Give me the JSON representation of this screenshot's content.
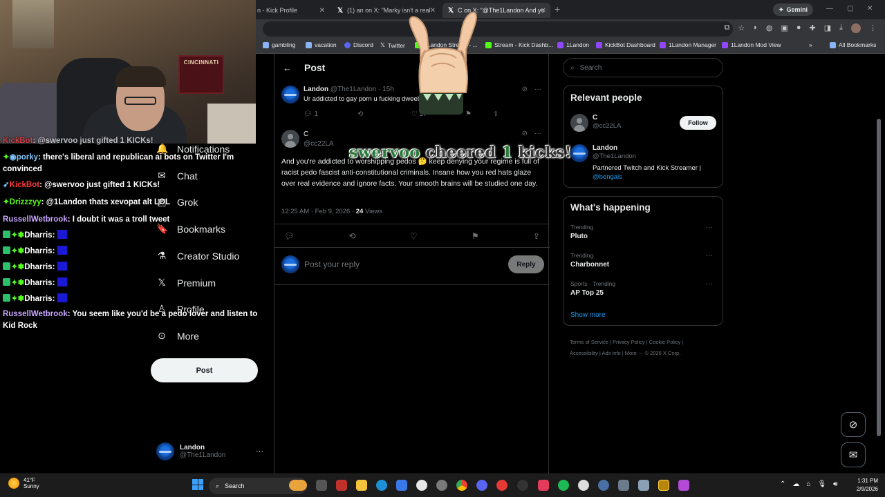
{
  "browser": {
    "tabs": [
      {
        "label": "n - Kick Profile",
        "active": false
      },
      {
        "label": "(1) an on X: \"Marky isn't a real",
        "active": false
      },
      {
        "label": "C on X: \"@The1Landon And yo",
        "active": true
      }
    ],
    "new_tab": "+",
    "gemini_label": "Gemini",
    "bookmarks": [
      {
        "label": "gambling",
        "color": "#8ab4f8"
      },
      {
        "label": "vacation",
        "color": "#8ab4f8"
      },
      {
        "label": "Discord",
        "color": "#5865f2"
      },
      {
        "label": "Twitter",
        "color": "#ffffff"
      },
      {
        "label": "1Landon Stream - ...",
        "color": "#53fc18"
      },
      {
        "label": "Stream - Kick Dashb...",
        "color": "#53fc18"
      },
      {
        "label": "1Landon",
        "color": "#9146ff"
      },
      {
        "label": "KickBot Dashboard",
        "color": "#9146ff"
      },
      {
        "label": "1Landon Manager",
        "color": "#9146ff"
      },
      {
        "label": "1Landon Mod View",
        "color": "#9146ff"
      }
    ],
    "all_bookmarks": "All Bookmarks"
  },
  "nav": {
    "items": [
      {
        "label": "Notifications",
        "icon": "bell-icon"
      },
      {
        "label": "Chat",
        "icon": "chat-icon"
      },
      {
        "label": "Grok",
        "icon": "grok-icon"
      },
      {
        "label": "Bookmarks",
        "icon": "bookmark-icon"
      },
      {
        "label": "Creator Studio",
        "icon": "flask-icon"
      },
      {
        "label": "Premium",
        "icon": "x-logo-icon"
      },
      {
        "label": "Profile",
        "icon": "person-icon"
      },
      {
        "label": "More",
        "icon": "more-circle-icon"
      }
    ],
    "post_button": "Post",
    "account": {
      "name": "Landon",
      "handle": "@The1Landon"
    }
  },
  "post_view": {
    "title": "Post",
    "parent_tweet": {
      "name": "Landon",
      "handle_time": "@The1Landon · 15h",
      "text": "Ur addicted to gay porn u fucking dweeb",
      "replies": "1",
      "likes": "27"
    },
    "main_tweet": {
      "name": "C",
      "handle": "@cc22LA",
      "text": "And you're addicted to worshipping pedos 🤔 keep denying your regime is full of racist pedo fascist anti-constitutional criminals. Insane how you red hats glaze over real evidence and ignore facts. Your smooth brains will be studied one day.",
      "time": "12:25 AM · Feb 9, 2026 · ",
      "views_count": "24",
      "views_label": " Views"
    },
    "reply_placeholder": "Post your reply",
    "reply_button": "Reply"
  },
  "sidebar": {
    "search_placeholder": "Search",
    "relevant_title": "Relevant people",
    "people": [
      {
        "name": "C",
        "handle": "@cc22LA",
        "follow": "Follow"
      },
      {
        "name": "Landon",
        "handle": "@The1Landon",
        "bio": "Partnered Twitch and Kick Streamer | ",
        "bio_link": "@bengals"
      }
    ],
    "happening_title": "What's happening",
    "trends": [
      {
        "category": "Trending",
        "name": "Pluto"
      },
      {
        "category": "Trending",
        "name": "Charbonnet"
      },
      {
        "category": "Sports · Trending",
        "name": "AP Top 25"
      }
    ],
    "show_more": "Show more",
    "footer_line1": "Terms of Service  |  Privacy Policy  |  Cookie Policy  |",
    "footer_line2": "Accessibility  |  Ads info  |  More ···  © 2026 X Corp."
  },
  "stream_overlay": {
    "banner": "CINCINNATI",
    "chat": [
      {
        "user": "KickBot",
        "text": "@swervoo just gifted 1 KICKs!",
        "color": "red"
      },
      {
        "user": "porky",
        "text": "there's liberal and republican ai bots on Twitter I'm convinced",
        "color": "blue"
      },
      {
        "user": "KickBot",
        "text": "@swervoo just gifted 1 KICKs!",
        "color": "red"
      },
      {
        "user": "Drizzzyy",
        "text": "@1Landon thats xevopat alt LOL",
        "color": "green"
      },
      {
        "user": "RussellWetbrook",
        "text": "I doubt it was a troll tweet",
        "color": "purple"
      },
      {
        "user": "Dharris",
        "text": "",
        "color": "white"
      },
      {
        "user": "Dharris",
        "text": "",
        "color": "white"
      },
      {
        "user": "Dharris",
        "text": "",
        "color": "white"
      },
      {
        "user": "Dharris",
        "text": "",
        "color": "white"
      },
      {
        "user": "Dharris",
        "text": "",
        "color": "white"
      },
      {
        "user": "RussellWetbrook",
        "text": "You seem like you'd be a pedo lover and listen to Kid Rock",
        "color": "purple"
      }
    ],
    "cheer": {
      "user": "swervoo",
      "mid": " cheered ",
      "amount": "1",
      "unit": " kicks!"
    }
  },
  "taskbar": {
    "temp": "41°F",
    "weather": "Sunny",
    "search": "Search",
    "time": "1:31 PM",
    "date": "2/9/2026"
  }
}
